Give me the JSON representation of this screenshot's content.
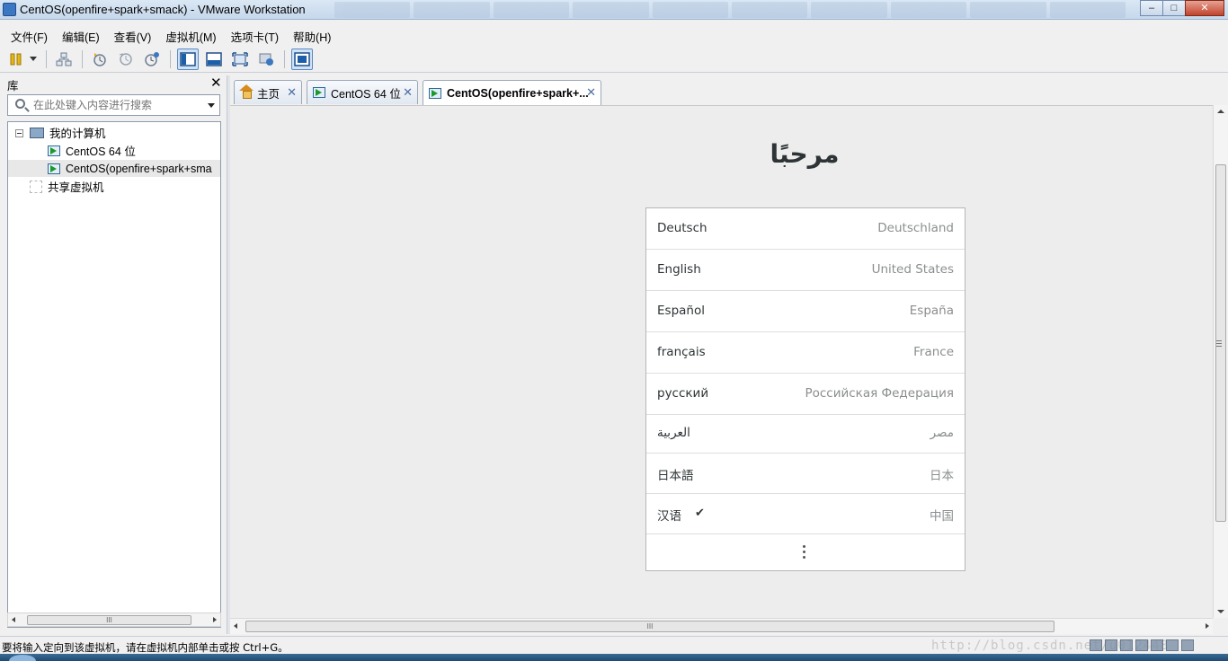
{
  "window": {
    "title": "CentOS(openfire+spark+smack) - VMware Workstation",
    "minimize": "–",
    "maximize": "□",
    "close": "✕"
  },
  "menu": [
    "文件(F)",
    "编辑(E)",
    "查看(V)",
    "虚拟机(M)",
    "选项卡(T)",
    "帮助(H)"
  ],
  "toolbar": {
    "icons": [
      "pause-icon",
      "dropdown-icon",
      "network-icon",
      "snapshot-take-icon",
      "snapshot-revert-icon",
      "snapshot-manager-icon",
      "library-view-icon",
      "console-view-icon",
      "fullscreen-icon",
      "unity-icon",
      "thumbnail-icon"
    ]
  },
  "library": {
    "title": "库",
    "close": "✕",
    "search_placeholder": "在此处键入内容进行搜索",
    "tree": [
      {
        "label": "我的计算机",
        "icon": "computer-icon",
        "level": 0
      },
      {
        "label": "CentOS 64 位",
        "icon": "vm-running-icon",
        "level": 1
      },
      {
        "label": "CentOS(openfire+spark+sma",
        "icon": "vm-running-icon",
        "level": 1,
        "selected": true
      },
      {
        "label": "共享虚拟机",
        "icon": "shared-vm-icon",
        "level": 0
      }
    ],
    "scroll_grip": "III"
  },
  "tabs": [
    {
      "label": "主页",
      "close": "✕",
      "icon": "home-icon"
    },
    {
      "label": "CentOS 64 位",
      "close": "✕",
      "icon": "vm-icon"
    },
    {
      "label": "CentOS(openfire+spark+...",
      "close": "✕",
      "icon": "vm-icon",
      "active": true
    }
  ],
  "guest": {
    "welcome": "مرحبًا",
    "languages": [
      {
        "name": "Deutsch",
        "region": "Deutschland"
      },
      {
        "name": "English",
        "region": "United States"
      },
      {
        "name": "Español",
        "region": "España"
      },
      {
        "name": "français",
        "region": "France"
      },
      {
        "name": "русский",
        "region": "Российская Федерация"
      },
      {
        "name": "العربية",
        "region": "مصر"
      },
      {
        "name": "日本語",
        "region": "日本"
      },
      {
        "name": "汉语",
        "region": "中国",
        "selected": true,
        "check": "✔"
      }
    ],
    "more_icon": "more-vertical-icon"
  },
  "main_scroll_grip": "III",
  "status": {
    "message": "要将输入定向到该虚拟机，请在虚拟机内部单击或按 Ctrl+G。",
    "watermark": "http://blog.csdn.net/u012448"
  },
  "colors": {
    "accent": "#3b78c4",
    "guest_bg": "#ededed",
    "run_green": "#1b9a2b"
  }
}
